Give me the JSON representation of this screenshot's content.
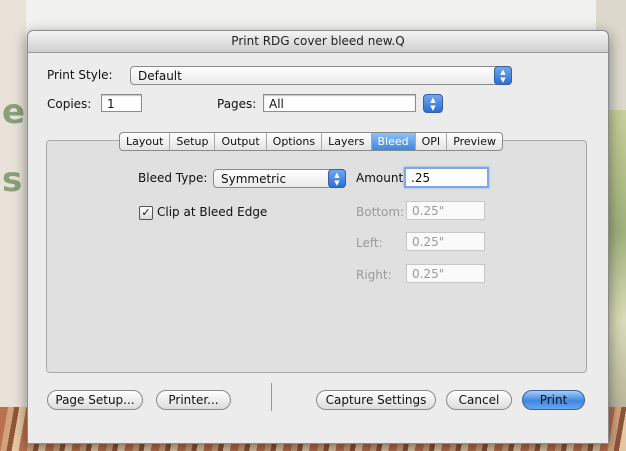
{
  "window": {
    "title": "Print RDG cover bleed new.Q"
  },
  "print_style": {
    "label": "Print Style:",
    "value": "Default"
  },
  "copies": {
    "label": "Copies:",
    "value": "1"
  },
  "pages": {
    "label": "Pages:",
    "value": "All"
  },
  "tabs": [
    {
      "label": "Layout",
      "active": false
    },
    {
      "label": "Setup",
      "active": false
    },
    {
      "label": "Output",
      "active": false
    },
    {
      "label": "Options",
      "active": false
    },
    {
      "label": "Layers",
      "active": false
    },
    {
      "label": "Bleed",
      "active": true
    },
    {
      "label": "OPI",
      "active": false
    },
    {
      "label": "Preview",
      "active": false
    }
  ],
  "bleed": {
    "type_label": "Bleed Type:",
    "type_value": "Symmetric",
    "amount_label": "Amount:",
    "amount_value": ".25",
    "bottom_label": "Bottom:",
    "bottom_value": "0.25\"",
    "left_label": "Left:",
    "left_value": "0.25\"",
    "right_label": "Right:",
    "right_value": "0.25\"",
    "clip_label": "Clip at Bleed Edge",
    "clip_checked": true
  },
  "buttons": {
    "page_setup": "Page Setup...",
    "printer": "Printer...",
    "capture": "Capture Settings",
    "cancel": "Cancel",
    "print": "Print"
  },
  "colors": {
    "accent": "#3f87e0",
    "background_banner": "#d97a5a"
  }
}
